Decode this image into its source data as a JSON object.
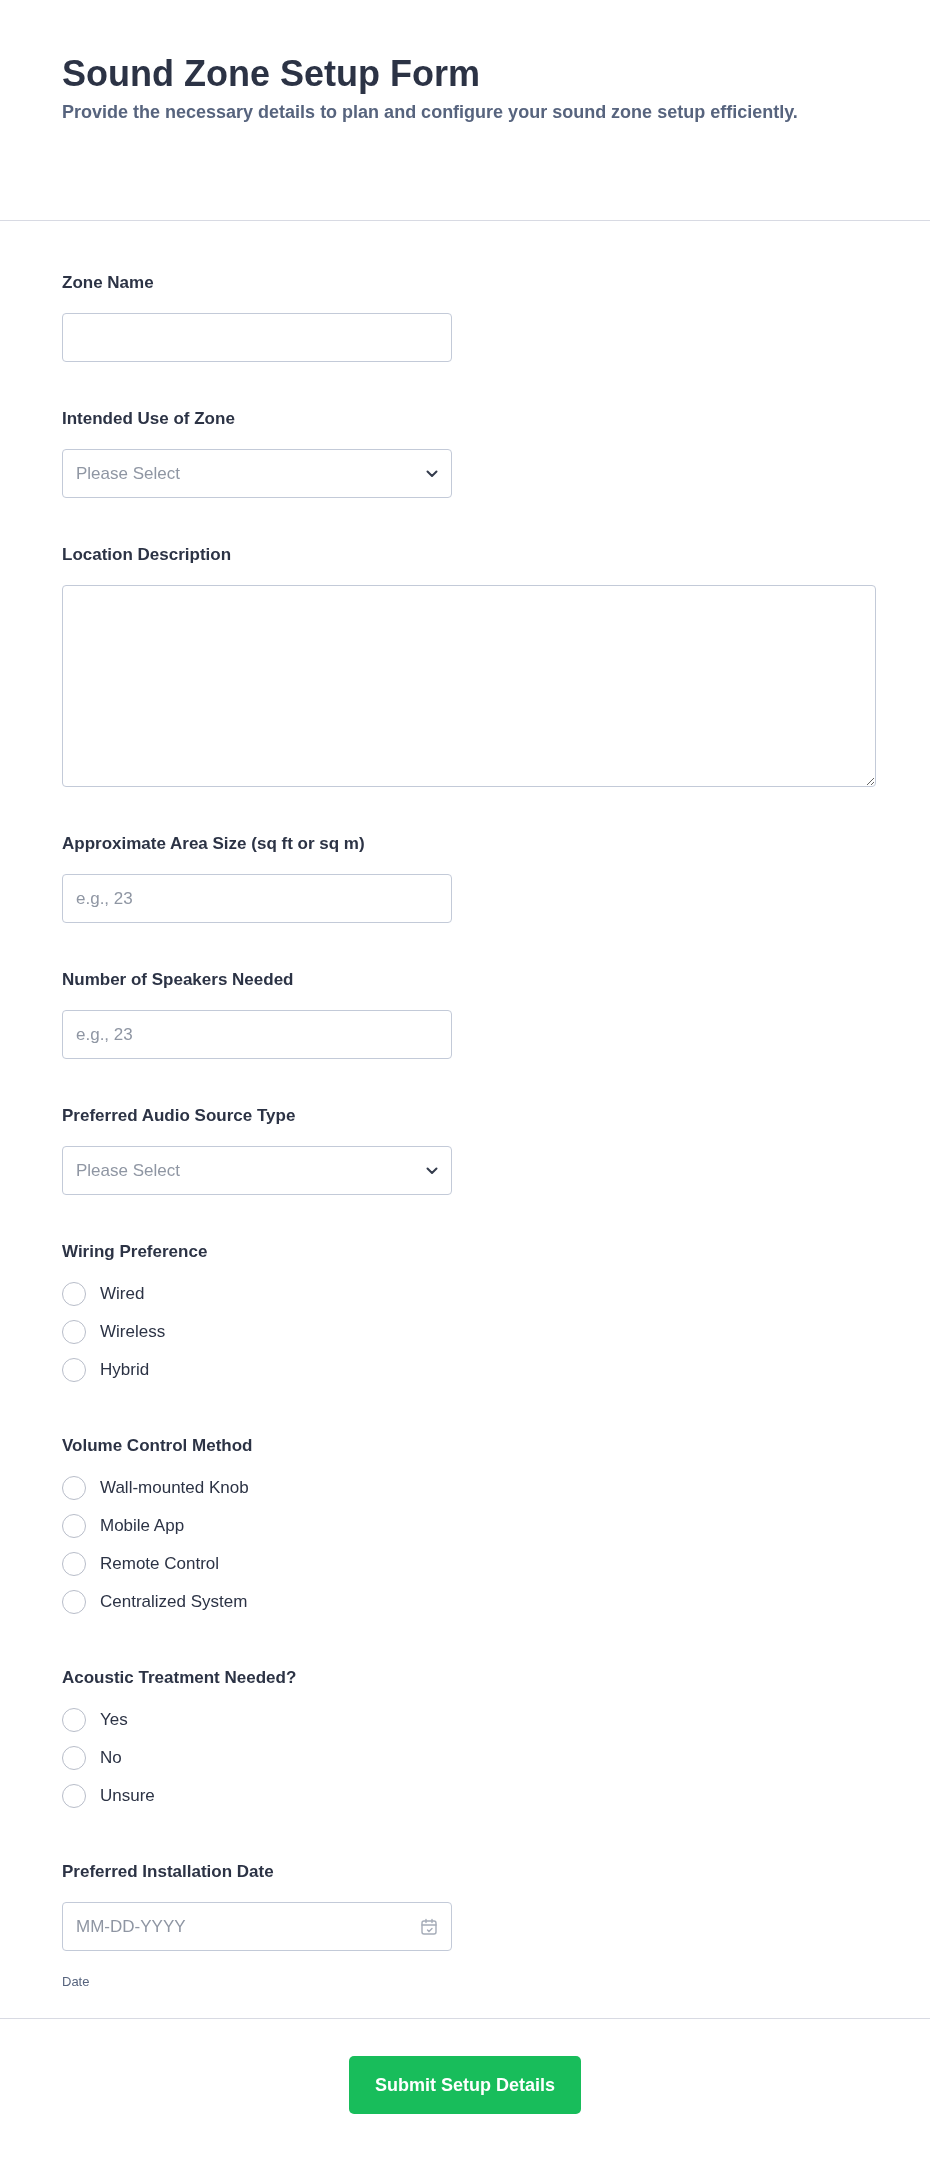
{
  "header": {
    "title": "Sound Zone Setup Form",
    "description": "Provide the necessary details to plan and configure your sound zone setup efficiently."
  },
  "fields": [
    {
      "kind": "text",
      "label": "Zone Name"
    },
    {
      "kind": "select",
      "label": "Intended Use of Zone",
      "placeholder": "Please Select"
    },
    {
      "kind": "textarea",
      "label": "Location Description"
    },
    {
      "kind": "text",
      "label": "Approximate Area Size (sq ft or sq m)",
      "placeholder": "e.g., 23"
    },
    {
      "kind": "text",
      "label": "Number of Speakers Needed",
      "placeholder": "e.g., 23"
    },
    {
      "kind": "select",
      "label": "Preferred Audio Source Type",
      "placeholder": "Please Select"
    },
    {
      "kind": "radio",
      "label": "Wiring Preference",
      "options": [
        {
          "label": "Wired",
          "selected": false
        },
        {
          "label": "Wireless",
          "selected": false
        },
        {
          "label": "Hybrid",
          "selected": false
        }
      ]
    },
    {
      "kind": "radio",
      "label": "Volume Control Method",
      "options": [
        {
          "label": "Wall-mounted Knob",
          "selected": false
        },
        {
          "label": "Mobile App",
          "selected": false
        },
        {
          "label": "Remote Control",
          "selected": false
        },
        {
          "label": "Centralized System",
          "selected": false
        }
      ]
    },
    {
      "kind": "radio",
      "label": "Acoustic Treatment Needed?",
      "options": [
        {
          "label": "Yes",
          "selected": false
        },
        {
          "label": "No",
          "selected": false
        },
        {
          "label": "Unsure",
          "selected": false
        }
      ]
    },
    {
      "kind": "date",
      "label": "Preferred Installation Date",
      "placeholder": "MM-DD-YYYY",
      "sublabel": "Date"
    }
  ],
  "submit": {
    "label": "Submit Setup Details"
  }
}
